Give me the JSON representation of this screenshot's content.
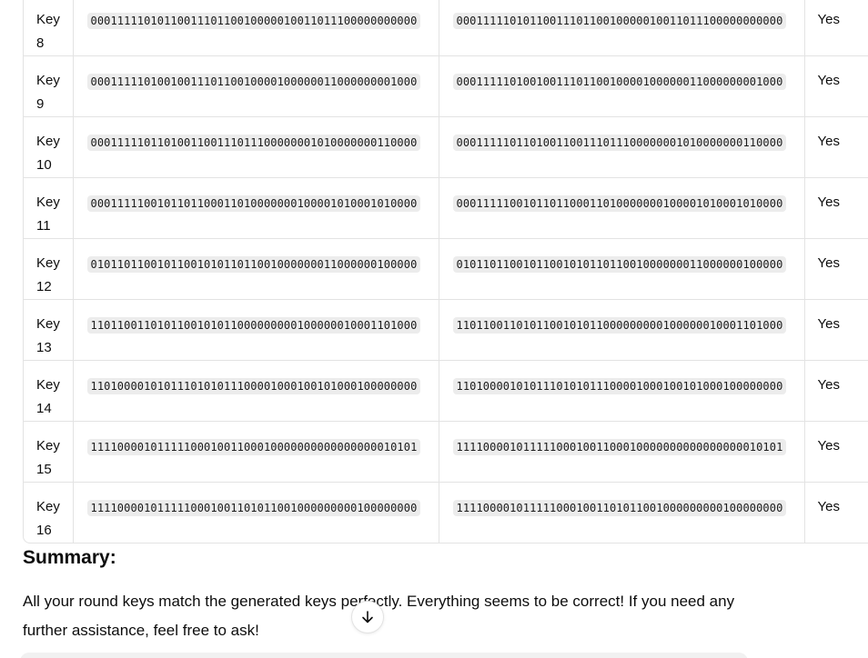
{
  "table": {
    "rows": [
      {
        "key_word": "Key",
        "key_num": "8",
        "your_key": "0001111101011001110110010000010011011100000000000",
        "generated_key": "0001111101011001110110010000010011011100000000000",
        "match": "Yes"
      },
      {
        "key_word": "Key",
        "key_num": "9",
        "your_key": "0001111101001001110110010000100000011000000001000",
        "generated_key": "0001111101001001110110010000100000011000000001000",
        "match": "Yes"
      },
      {
        "key_word": "Key",
        "key_num": "10",
        "your_key": "0001111101101001100111011100000001010000000110000",
        "generated_key": "0001111101101001100111011100000001010000000110000",
        "match": "Yes"
      },
      {
        "key_word": "Key",
        "key_num": "11",
        "your_key": "0001111100101101100011010000000100001010001010000",
        "generated_key": "0001111100101101100011010000000100001010001010000",
        "match": "Yes"
      },
      {
        "key_word": "Key",
        "key_num": "12",
        "your_key": "0101101100101100101011011001000000011000000100000",
        "generated_key": "0101101100101100101011011001000000011000000100000",
        "match": "Yes"
      },
      {
        "key_word": "Key",
        "key_num": "13",
        "your_key": "1101100110101100101011000000000100000010001101000",
        "generated_key": "1101100110101100101011000000000100000010001101000",
        "match": "Yes"
      },
      {
        "key_word": "Key",
        "key_num": "14",
        "your_key": "1101000010101110101011100001000100101000100000000",
        "generated_key": "1101000010101110101011100001000100101000100000000",
        "match": "Yes"
      },
      {
        "key_word": "Key",
        "key_num": "15",
        "your_key": "1111000010111110001001100010000000000000000010101",
        "generated_key": "1111000010111110001001100010000000000000000010101",
        "match": "Yes"
      },
      {
        "key_word": "Key",
        "key_num": "16",
        "your_key": "1111000010111110001001101011001000000000100000000",
        "generated_key": "1111000010111110001001101011001000000000100000000",
        "match": "Yes"
      }
    ]
  },
  "summary": {
    "title": "Summary:",
    "text": "All your round keys match the generated keys perfectly. Everything seems to be correct! If you need any further assistance, feel free to ask!"
  },
  "scroll_button": {
    "icon": "arrow-down-icon"
  }
}
